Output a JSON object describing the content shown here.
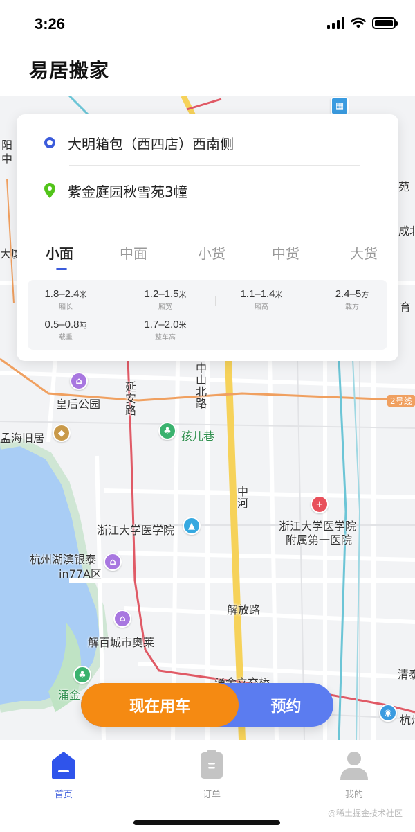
{
  "status": {
    "time": "3:26"
  },
  "app": {
    "title": "易居搬家"
  },
  "route": {
    "start": "大明箱包（西四店）西南侧",
    "end": "紫金庭园秋雪苑3幢"
  },
  "vehicle_tabs": [
    {
      "label": "小面",
      "active": true
    },
    {
      "label": "中面",
      "active": false
    },
    {
      "label": "小货",
      "active": false
    },
    {
      "label": "中货",
      "active": false
    },
    {
      "label": "大货",
      "active": false
    }
  ],
  "specs": [
    {
      "value": "1.8–2.4",
      "unit": "米",
      "label": "厢长"
    },
    {
      "value": "1.2–1.5",
      "unit": "米",
      "label": "厢宽"
    },
    {
      "value": "1.1–1.4",
      "unit": "米",
      "label": "厢高"
    },
    {
      "value": "2.4–5",
      "unit": "方",
      "label": "载方"
    },
    {
      "value": "0.5–0.8",
      "unit": "吨",
      "label": "载重"
    },
    {
      "value": "1.7–2.0",
      "unit": "米",
      "label": "整车高"
    }
  ],
  "map": {
    "labels": {
      "huanghou": "皇后公园",
      "yanan": "延安路",
      "zhongshan": "中山北路",
      "haier": "孩儿巷",
      "mengtai": "孟海旧居",
      "zhonghe": "中河",
      "zjmed": "浙江大学医学院",
      "hospital1": "浙江大学医学院",
      "hospital2": "附属第一医院",
      "yintai1": "杭州湖滨银泰",
      "yintai2": "in77A区",
      "jiefang": "解放路",
      "jiebai": "解百城市奥莱",
      "yongjin_bridge": "涌金立交桥",
      "yongjin": "涌金",
      "line2": "2号线",
      "qingtai": "清泰",
      "hangzhou": "杭州",
      "yang": "阳",
      "zhong": "中",
      "daxia": "大厦",
      "yuan": "苑",
      "cheng": "成北",
      "yu": "育"
    }
  },
  "actions": {
    "now": "现在用车",
    "reserve": "预约"
  },
  "tabbar": [
    {
      "label": "首页",
      "active": true
    },
    {
      "label": "订单",
      "active": false
    },
    {
      "label": "我的",
      "active": false
    }
  ],
  "watermark": "@稀土掘金技术社区",
  "colors": {
    "accent": "#3b5bdb",
    "orange": "#f58a12",
    "blue_button": "#5b7cf0",
    "pin_green": "#52c41a"
  }
}
